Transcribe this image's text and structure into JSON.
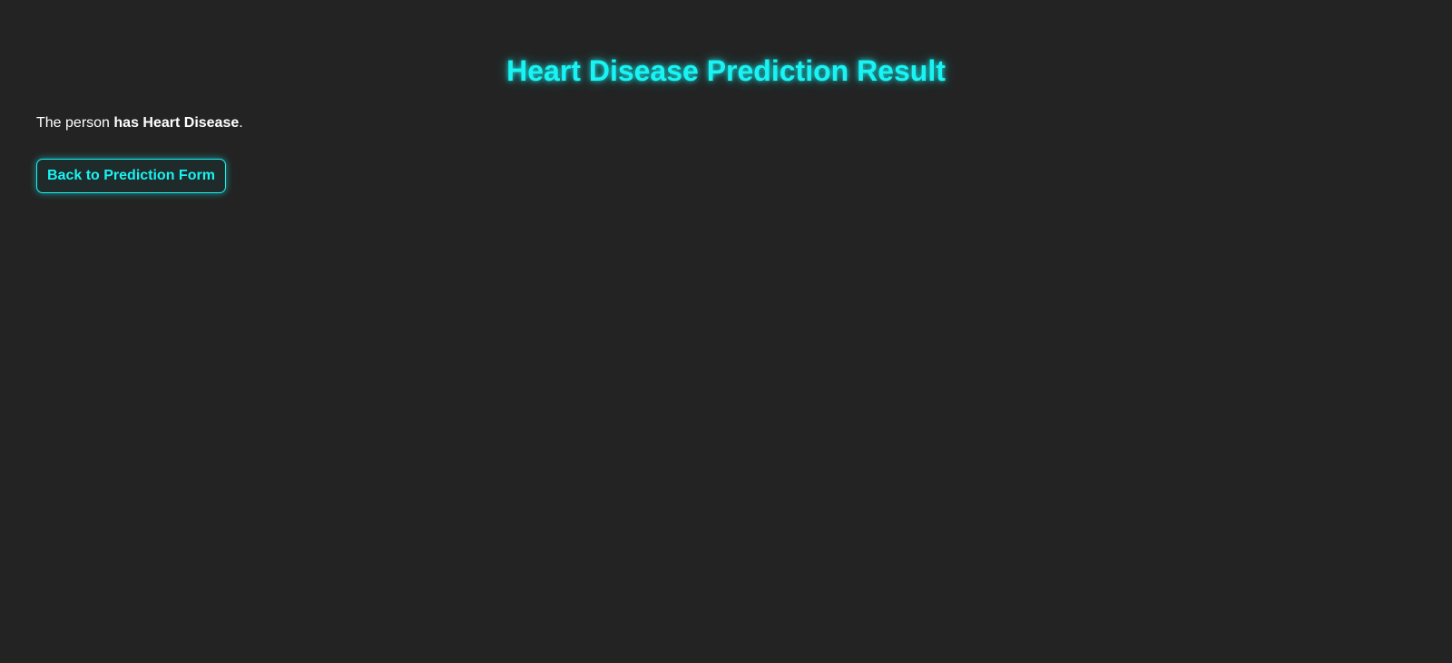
{
  "page": {
    "title": "Heart Disease Prediction Result"
  },
  "result": {
    "prefix": "The person ",
    "outcome": "has Heart Disease",
    "suffix": "."
  },
  "actions": {
    "back_label": "Back to Prediction Form"
  },
  "colors": {
    "background": "#232323",
    "accent": "#19f3f3",
    "text": "#ffffff"
  }
}
